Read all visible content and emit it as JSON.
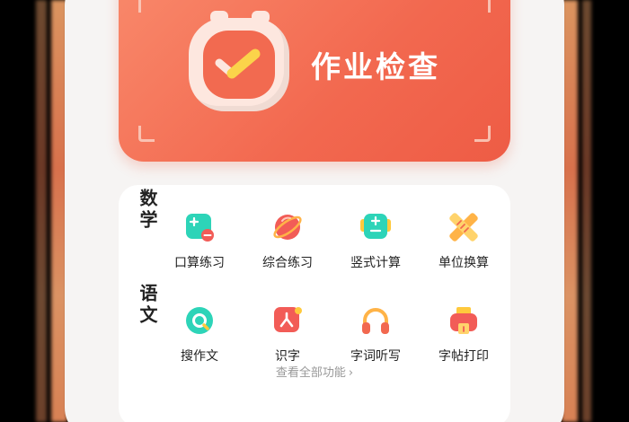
{
  "hero": {
    "title": "作业检查",
    "icon": "checklist-timer-icon",
    "color": "#f2684f"
  },
  "sections": [
    {
      "category": "数学",
      "items": [
        {
          "label": "口算练习",
          "icon": "mental-math-icon"
        },
        {
          "label": "综合练习",
          "icon": "planet-practice-icon"
        },
        {
          "label": "竖式计算",
          "icon": "calculator-icon"
        },
        {
          "label": "单位换算",
          "icon": "ruler-cross-icon"
        }
      ]
    },
    {
      "category": "语文",
      "items": [
        {
          "label": "搜作文",
          "icon": "magnifier-essay-icon"
        },
        {
          "label": "识字",
          "icon": "character-card-icon"
        },
        {
          "label": "字词听写",
          "icon": "headphones-icon"
        },
        {
          "label": "字帖打印",
          "icon": "printer-icon"
        }
      ]
    }
  ],
  "footer": {
    "more_label": "查看全部功能",
    "chevron": "›"
  }
}
